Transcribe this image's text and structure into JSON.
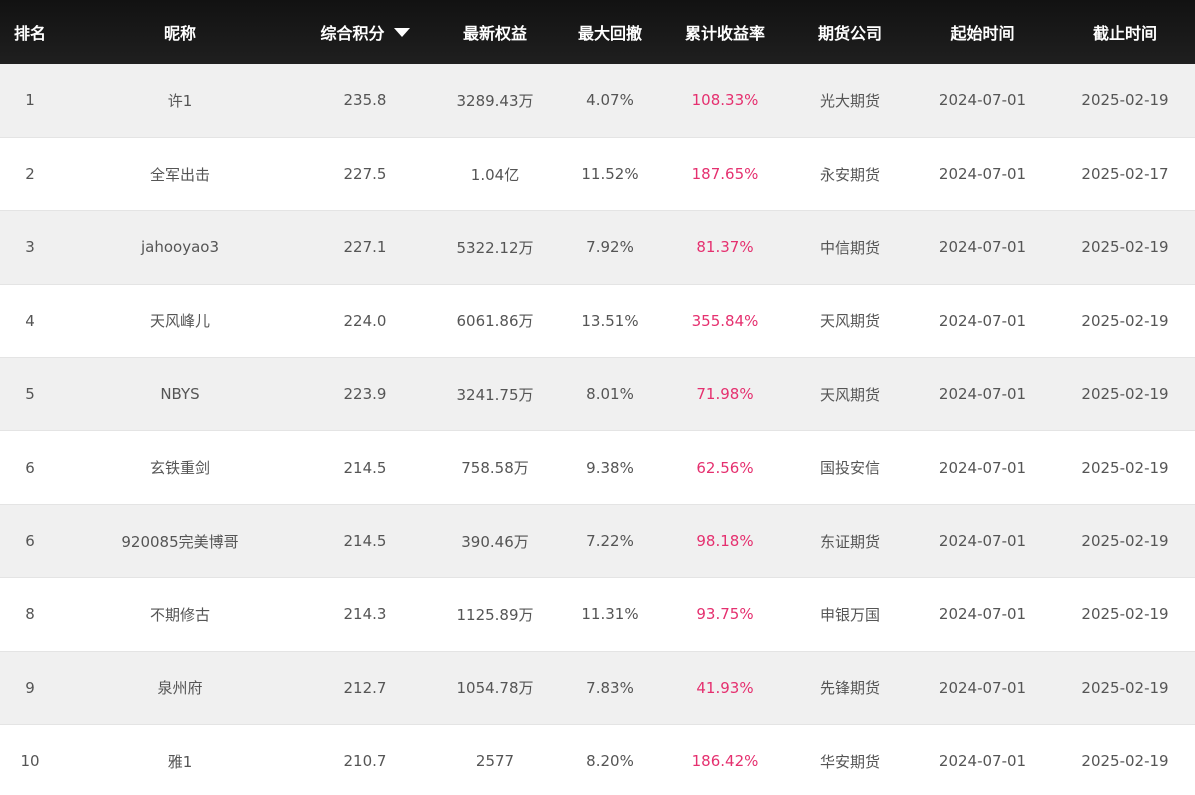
{
  "table": {
    "headers": {
      "rank": "排名",
      "nickname": "昵称",
      "score": "综合积分",
      "equity": "最新权益",
      "drawdown": "最大回撤",
      "return_rate": "累计收益率",
      "company": "期货公司",
      "start": "起始时间",
      "end": "截止时间"
    },
    "sort": {
      "column": "score",
      "direction": "desc",
      "icon": "triangle-down-icon"
    },
    "colors": {
      "header_bg": "#1a1a1a",
      "rate": "#e5306f",
      "stripe": "#f0f0f0"
    },
    "rows": [
      {
        "rank": "1",
        "nickname": "许1",
        "score": "235.8",
        "equity": "3289.43万",
        "drawdown": "4.07%",
        "return_rate": "108.33%",
        "company": "光大期货",
        "start": "2024-07-01",
        "end": "2025-02-19"
      },
      {
        "rank": "2",
        "nickname": "全军出击",
        "score": "227.5",
        "equity": "1.04亿",
        "drawdown": "11.52%",
        "return_rate": "187.65%",
        "company": "永安期货",
        "start": "2024-07-01",
        "end": "2025-02-17"
      },
      {
        "rank": "3",
        "nickname": "jahooyao3",
        "score": "227.1",
        "equity": "5322.12万",
        "drawdown": "7.92%",
        "return_rate": "81.37%",
        "company": "中信期货",
        "start": "2024-07-01",
        "end": "2025-02-19"
      },
      {
        "rank": "4",
        "nickname": "天风峰儿",
        "score": "224.0",
        "equity": "6061.86万",
        "drawdown": "13.51%",
        "return_rate": "355.84%",
        "company": "天风期货",
        "start": "2024-07-01",
        "end": "2025-02-19"
      },
      {
        "rank": "5",
        "nickname": "NBYS",
        "score": "223.9",
        "equity": "3241.75万",
        "drawdown": "8.01%",
        "return_rate": "71.98%",
        "company": "天风期货",
        "start": "2024-07-01",
        "end": "2025-02-19"
      },
      {
        "rank": "6",
        "nickname": "玄铁重剑",
        "score": "214.5",
        "equity": "758.58万",
        "drawdown": "9.38%",
        "return_rate": "62.56%",
        "company": "国投安信",
        "start": "2024-07-01",
        "end": "2025-02-19"
      },
      {
        "rank": "6",
        "nickname": "920085完美博哥",
        "score": "214.5",
        "equity": "390.46万",
        "drawdown": "7.22%",
        "return_rate": "98.18%",
        "company": "东证期货",
        "start": "2024-07-01",
        "end": "2025-02-19"
      },
      {
        "rank": "8",
        "nickname": "不期修古",
        "score": "214.3",
        "equity": "1125.89万",
        "drawdown": "11.31%",
        "return_rate": "93.75%",
        "company": "申银万国",
        "start": "2024-07-01",
        "end": "2025-02-19"
      },
      {
        "rank": "9",
        "nickname": "泉州府",
        "score": "212.7",
        "equity": "1054.78万",
        "drawdown": "7.83%",
        "return_rate": "41.93%",
        "company": "先锋期货",
        "start": "2024-07-01",
        "end": "2025-02-19"
      },
      {
        "rank": "10",
        "nickname": "雅1",
        "score": "210.7",
        "equity": "2577",
        "drawdown": "8.20%",
        "return_rate": "186.42%",
        "company": "华安期货",
        "start": "2024-07-01",
        "end": "2025-02-19"
      }
    ]
  }
}
